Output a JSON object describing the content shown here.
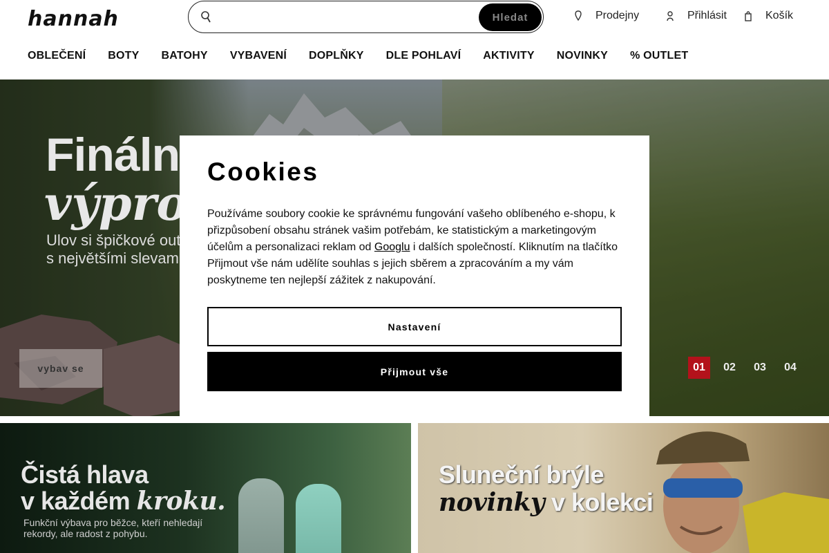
{
  "brand": {
    "logo_text": "hannah",
    "accent_color": "#b3121b"
  },
  "search": {
    "placeholder": "",
    "button_label": "Hledat"
  },
  "header_links": [
    {
      "label": "Prodejny",
      "icon": "store-pin-icon"
    },
    {
      "label": "Přihlásit",
      "icon": "user-icon"
    },
    {
      "label": "Košík",
      "icon": "cart-icon"
    }
  ],
  "nav": [
    "OBLEČENÍ",
    "BOTY",
    "BATOHY",
    "VYBAVENÍ",
    "DOPLŇKY",
    "DLE POHLAVÍ",
    "AKTIVITY",
    "NOVINKY",
    "% OUTLET"
  ],
  "hero": {
    "title_line1": "Finální",
    "title_line2": "výprodej",
    "subtitle_line1": "Ulov si špičkové outdoorové",
    "subtitle_line2": "s největšími slevami",
    "cta_label": "vybav se",
    "slides": [
      "01",
      "02",
      "03",
      "04"
    ],
    "active_slide": "01"
  },
  "promos": [
    {
      "line1": "Čistá hlava",
      "line2_plain": "v každém ",
      "line2_italic": "kroku.",
      "text": "Funkční výbava pro běžce, kteří nehledají rekordy, ale radost z pohybu."
    },
    {
      "line1": "Sluneční brýle",
      "line2_italic": "novinky",
      "line2_plain": " v kolekci"
    }
  ],
  "cookies": {
    "title": "Cookies",
    "text_before_link": "Používáme soubory cookie ke správnému fungování vašeho oblíbeného e-shopu, k přizpůsobení obsahu stránek vašim potřebám, ke statistickým a marketingovým účelům a personalizaci reklam od ",
    "link_text": "Googlu",
    "text_after_link": " i dalších společností. Kliknutím na tlačítko Přijmout vše nám udělíte souhlas s jejich sběrem a zpracováním a my vám poskytneme ten nejlepší zážitek z nakupování.",
    "settings_label": "Nastavení",
    "accept_label": "Přijmout vše"
  }
}
